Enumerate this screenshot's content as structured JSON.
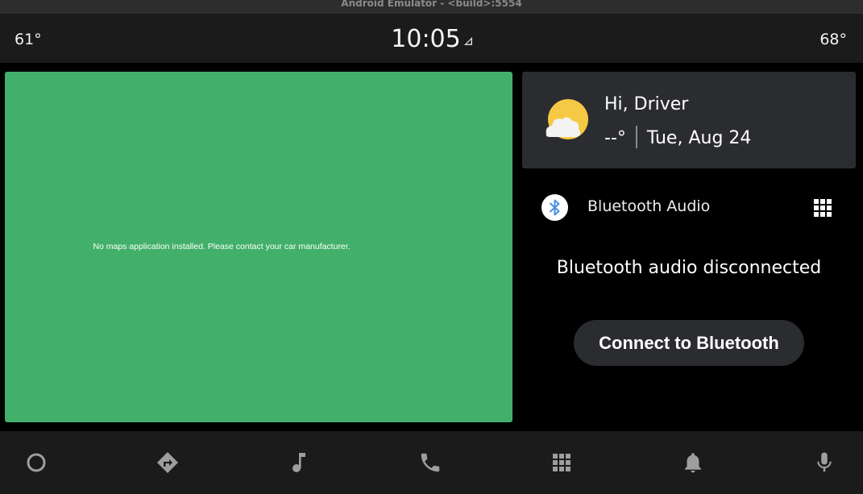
{
  "window": {
    "title": "Android Emulator - <build>:5554"
  },
  "status_bar": {
    "temp_left": "61°",
    "clock": "10:05",
    "temp_right": "68°",
    "signal_icon": "signal-icon"
  },
  "map": {
    "message": "No maps application installed. Please contact your car manufacturer.",
    "background_color": "#42b06a"
  },
  "greeting": {
    "title": "Hi, Driver",
    "temperature": "--°",
    "date": "Tue, Aug 24",
    "weather_icon": "partly-cloudy-icon"
  },
  "media": {
    "source_icon": "bluetooth-icon",
    "source_title": "Bluetooth Audio",
    "apps_icon": "grid-icon",
    "status": "Bluetooth audio disconnected",
    "connect_button": "Connect to Bluetooth"
  },
  "nav": {
    "items": [
      "home-icon",
      "navigation-icon",
      "music-icon",
      "phone-icon",
      "apps-grid-icon",
      "notifications-icon",
      "microphone-icon"
    ]
  },
  "colors": {
    "accent": "#42b06a",
    "card": "#2b2c30",
    "bar": "#1b1b1b",
    "icon": "#9e9e9e"
  }
}
